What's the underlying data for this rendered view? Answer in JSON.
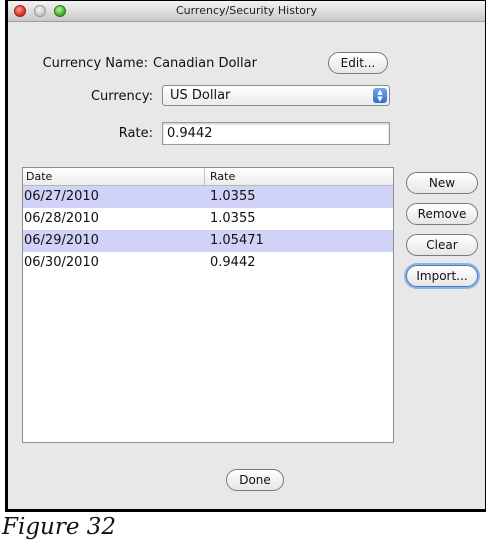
{
  "window": {
    "title": "Currency/Security History"
  },
  "form": {
    "currency_name_label": "Currency Name:",
    "currency_name_value": "Canadian Dollar",
    "edit_button": "Edit...",
    "currency_label": "Currency:",
    "currency_selected": "US Dollar",
    "rate_label": "Rate:",
    "rate_value": "0.9442"
  },
  "table": {
    "columns": [
      "Date",
      "Rate"
    ],
    "rows": [
      {
        "date": "06/27/2010",
        "rate": "1.0355"
      },
      {
        "date": "06/28/2010",
        "rate": "1.0355"
      },
      {
        "date": "06/29/2010",
        "rate": "1.05471"
      },
      {
        "date": "06/30/2010",
        "rate": "0.9442"
      }
    ]
  },
  "actions": {
    "new": "New",
    "remove": "Remove",
    "clear": "Clear",
    "import": "Import...",
    "done": "Done"
  },
  "caption": "Figure 32",
  "colors": {
    "row_highlight": "#d0d3f7",
    "window_bg": "#e8e8e8"
  }
}
